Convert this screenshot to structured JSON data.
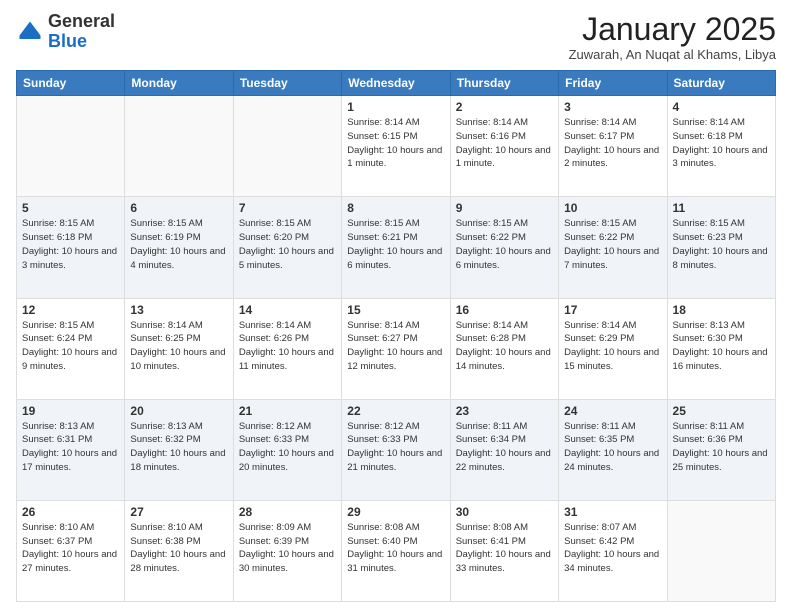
{
  "logo": {
    "general": "General",
    "blue": "Blue"
  },
  "header": {
    "month_title": "January 2025",
    "location": "Zuwarah, An Nuqat al Khams, Libya"
  },
  "days_of_week": [
    "Sunday",
    "Monday",
    "Tuesday",
    "Wednesday",
    "Thursday",
    "Friday",
    "Saturday"
  ],
  "weeks": [
    [
      {
        "day": "",
        "info": ""
      },
      {
        "day": "",
        "info": ""
      },
      {
        "day": "",
        "info": ""
      },
      {
        "day": "1",
        "info": "Sunrise: 8:14 AM\nSunset: 6:15 PM\nDaylight: 10 hours\nand 1 minute."
      },
      {
        "day": "2",
        "info": "Sunrise: 8:14 AM\nSunset: 6:16 PM\nDaylight: 10 hours\nand 1 minute."
      },
      {
        "day": "3",
        "info": "Sunrise: 8:14 AM\nSunset: 6:17 PM\nDaylight: 10 hours\nand 2 minutes."
      },
      {
        "day": "4",
        "info": "Sunrise: 8:14 AM\nSunset: 6:18 PM\nDaylight: 10 hours\nand 3 minutes."
      }
    ],
    [
      {
        "day": "5",
        "info": "Sunrise: 8:15 AM\nSunset: 6:18 PM\nDaylight: 10 hours\nand 3 minutes."
      },
      {
        "day": "6",
        "info": "Sunrise: 8:15 AM\nSunset: 6:19 PM\nDaylight: 10 hours\nand 4 minutes."
      },
      {
        "day": "7",
        "info": "Sunrise: 8:15 AM\nSunset: 6:20 PM\nDaylight: 10 hours\nand 5 minutes."
      },
      {
        "day": "8",
        "info": "Sunrise: 8:15 AM\nSunset: 6:21 PM\nDaylight: 10 hours\nand 6 minutes."
      },
      {
        "day": "9",
        "info": "Sunrise: 8:15 AM\nSunset: 6:22 PM\nDaylight: 10 hours\nand 6 minutes."
      },
      {
        "day": "10",
        "info": "Sunrise: 8:15 AM\nSunset: 6:22 PM\nDaylight: 10 hours\nand 7 minutes."
      },
      {
        "day": "11",
        "info": "Sunrise: 8:15 AM\nSunset: 6:23 PM\nDaylight: 10 hours\nand 8 minutes."
      }
    ],
    [
      {
        "day": "12",
        "info": "Sunrise: 8:15 AM\nSunset: 6:24 PM\nDaylight: 10 hours\nand 9 minutes."
      },
      {
        "day": "13",
        "info": "Sunrise: 8:14 AM\nSunset: 6:25 PM\nDaylight: 10 hours\nand 10 minutes."
      },
      {
        "day": "14",
        "info": "Sunrise: 8:14 AM\nSunset: 6:26 PM\nDaylight: 10 hours\nand 11 minutes."
      },
      {
        "day": "15",
        "info": "Sunrise: 8:14 AM\nSunset: 6:27 PM\nDaylight: 10 hours\nand 12 minutes."
      },
      {
        "day": "16",
        "info": "Sunrise: 8:14 AM\nSunset: 6:28 PM\nDaylight: 10 hours\nand 14 minutes."
      },
      {
        "day": "17",
        "info": "Sunrise: 8:14 AM\nSunset: 6:29 PM\nDaylight: 10 hours\nand 15 minutes."
      },
      {
        "day": "18",
        "info": "Sunrise: 8:13 AM\nSunset: 6:30 PM\nDaylight: 10 hours\nand 16 minutes."
      }
    ],
    [
      {
        "day": "19",
        "info": "Sunrise: 8:13 AM\nSunset: 6:31 PM\nDaylight: 10 hours\nand 17 minutes."
      },
      {
        "day": "20",
        "info": "Sunrise: 8:13 AM\nSunset: 6:32 PM\nDaylight: 10 hours\nand 18 minutes."
      },
      {
        "day": "21",
        "info": "Sunrise: 8:12 AM\nSunset: 6:33 PM\nDaylight: 10 hours\nand 20 minutes."
      },
      {
        "day": "22",
        "info": "Sunrise: 8:12 AM\nSunset: 6:33 PM\nDaylight: 10 hours\nand 21 minutes."
      },
      {
        "day": "23",
        "info": "Sunrise: 8:11 AM\nSunset: 6:34 PM\nDaylight: 10 hours\nand 22 minutes."
      },
      {
        "day": "24",
        "info": "Sunrise: 8:11 AM\nSunset: 6:35 PM\nDaylight: 10 hours\nand 24 minutes."
      },
      {
        "day": "25",
        "info": "Sunrise: 8:11 AM\nSunset: 6:36 PM\nDaylight: 10 hours\nand 25 minutes."
      }
    ],
    [
      {
        "day": "26",
        "info": "Sunrise: 8:10 AM\nSunset: 6:37 PM\nDaylight: 10 hours\nand 27 minutes."
      },
      {
        "day": "27",
        "info": "Sunrise: 8:10 AM\nSunset: 6:38 PM\nDaylight: 10 hours\nand 28 minutes."
      },
      {
        "day": "28",
        "info": "Sunrise: 8:09 AM\nSunset: 6:39 PM\nDaylight: 10 hours\nand 30 minutes."
      },
      {
        "day": "29",
        "info": "Sunrise: 8:08 AM\nSunset: 6:40 PM\nDaylight: 10 hours\nand 31 minutes."
      },
      {
        "day": "30",
        "info": "Sunrise: 8:08 AM\nSunset: 6:41 PM\nDaylight: 10 hours\nand 33 minutes."
      },
      {
        "day": "31",
        "info": "Sunrise: 8:07 AM\nSunset: 6:42 PM\nDaylight: 10 hours\nand 34 minutes."
      },
      {
        "day": "",
        "info": ""
      }
    ]
  ]
}
